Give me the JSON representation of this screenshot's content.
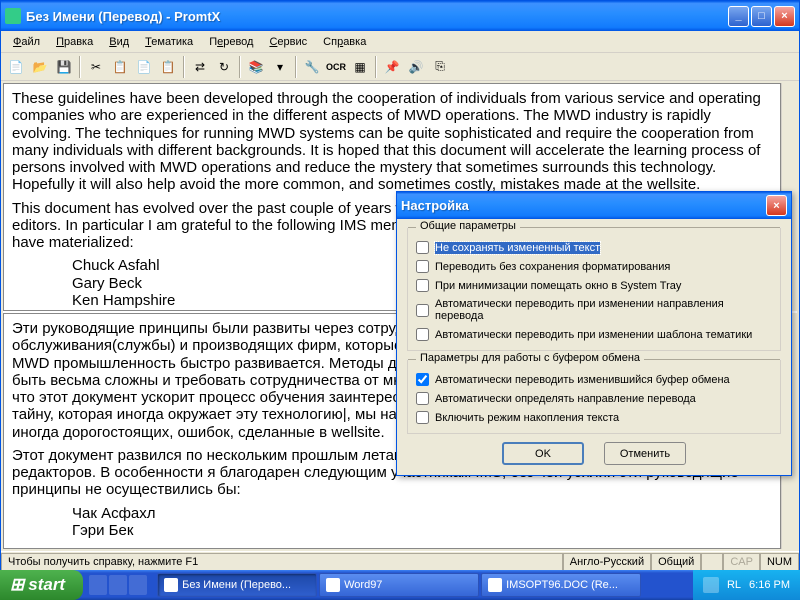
{
  "window": {
    "title": "Без Имени (Перевод) - PromtX",
    "menus": [
      "Файл",
      "Правка",
      "Вид",
      "Тематика",
      "Перевод",
      "Сервис",
      "Справка"
    ]
  },
  "doc": {
    "p1": "These guidelines have been developed through the cooperation of individuals from various service and operating companies who are experienced in the different aspects of MWD operations.  The MWD industry is rapidly evolving.  The techniques for running MWD systems can be quite sophisticated and require the cooperation from many individuals with different backgrounds.  It is hoped that this document will accelerate the learning process of persons involved with MWD operations and reduce the mystery that sometimes surrounds this technology.  Hopefully it will also help avoid the more common, and sometimes costly, mistakes made at the wellsite.",
    "p2": "This document has evolved over the past couple of years with the input from many different contributors and editors.  In particular I am grateful to the following IMS members, without whose efforts these guidelines would not have materialized:",
    "names": [
      "Chuck Asfahl",
      "Gary Beck",
      "Ken Hampshire"
    ],
    "rp1": "Эти руководящие принципы были развиты через сотрудничество индивидуумов от различного обслуживания(службы) и производящих фирм, которые испытаны в различных аспектах MWD операций. MWD промышленность быстро развивается. Методы для того, чтобы управлять системами MWD могут быть весьма сложны и требовать сотрудничества от многих людей с различными фонами. Есть надежда, что этот документ ускорит процесс обучения заинтересованных лиц с операциями MWD, и уменьшает тайну, которая иногда окружает эту технологию|, мы надеемся, это также поможет избегать более общих, и иногда дорогостоящих, ошибок, сделанные в wellsite.",
    "rp2": "Этот документ развился по нескольким прошлым летам с входом от множества различных вкладчиков и редакторов. В особенности я благодарен следующим участникам IMS, без чей усилий эти руководящие принципы не осуществились бы:",
    "rnames": [
      "Чак Асфахл",
      "Гэри Бек"
    ]
  },
  "status": {
    "help": "Чтобы получить справку, нажмите F1",
    "lang": "Англо-Русский",
    "template": "Общий",
    "cap": "CAP",
    "num": "NUM"
  },
  "dialog": {
    "title": "Настройка",
    "group1": "Общие параметры",
    "opts1": [
      {
        "label": "Не сохранять измененный текст",
        "checked": false,
        "hl": true
      },
      {
        "label": "Переводить без сохранения форматирования",
        "checked": false
      },
      {
        "label": "При минимизации помещать окно в System Tray",
        "checked": false
      },
      {
        "label": "Автоматически переводить при изменении направления перевода",
        "checked": false
      },
      {
        "label": "Автоматически переводить при изменении шаблона тематики",
        "checked": false
      }
    ],
    "group2": "Параметры для работы с буфером обмена",
    "opts2": [
      {
        "label": "Автоматически переводить изменившийся буфер обмена",
        "checked": true
      },
      {
        "label": "Автоматически определять направление перевода",
        "checked": false
      },
      {
        "label": "Включить режим накопления текста",
        "checked": false
      }
    ],
    "ok": "OK",
    "cancel": "Отменить"
  },
  "taskbar": {
    "start": "start",
    "tasks": [
      {
        "label": "Без Имени (Перево...",
        "active": true
      },
      {
        "label": "Word97",
        "active": false
      },
      {
        "label": "IMSOPT96.DOC (Re...",
        "active": false
      }
    ],
    "lang": "RL",
    "time": "6:16 PM"
  }
}
